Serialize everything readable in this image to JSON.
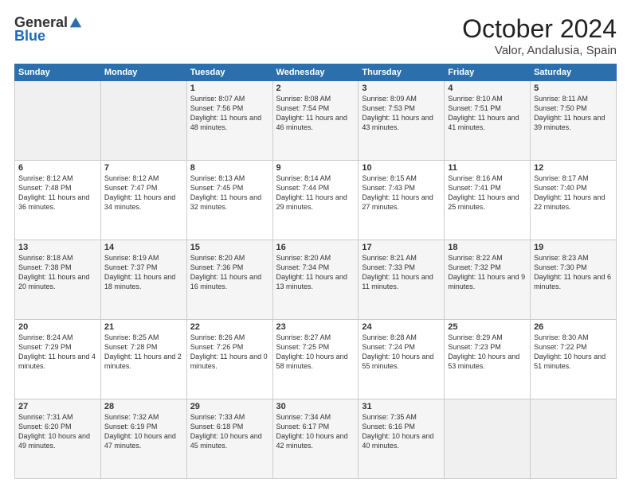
{
  "header": {
    "logo_general": "General",
    "logo_blue": "Blue",
    "month": "October 2024",
    "location": "Valor, Andalusia, Spain"
  },
  "weekdays": [
    "Sunday",
    "Monday",
    "Tuesday",
    "Wednesday",
    "Thursday",
    "Friday",
    "Saturday"
  ],
  "weeks": [
    [
      {
        "day": "",
        "info": ""
      },
      {
        "day": "",
        "info": ""
      },
      {
        "day": "1",
        "info": "Sunrise: 8:07 AM\nSunset: 7:56 PM\nDaylight: 11 hours and 48 minutes."
      },
      {
        "day": "2",
        "info": "Sunrise: 8:08 AM\nSunset: 7:54 PM\nDaylight: 11 hours and 46 minutes."
      },
      {
        "day": "3",
        "info": "Sunrise: 8:09 AM\nSunset: 7:53 PM\nDaylight: 11 hours and 43 minutes."
      },
      {
        "day": "4",
        "info": "Sunrise: 8:10 AM\nSunset: 7:51 PM\nDaylight: 11 hours and 41 minutes."
      },
      {
        "day": "5",
        "info": "Sunrise: 8:11 AM\nSunset: 7:50 PM\nDaylight: 11 hours and 39 minutes."
      }
    ],
    [
      {
        "day": "6",
        "info": "Sunrise: 8:12 AM\nSunset: 7:48 PM\nDaylight: 11 hours and 36 minutes."
      },
      {
        "day": "7",
        "info": "Sunrise: 8:12 AM\nSunset: 7:47 PM\nDaylight: 11 hours and 34 minutes."
      },
      {
        "day": "8",
        "info": "Sunrise: 8:13 AM\nSunset: 7:45 PM\nDaylight: 11 hours and 32 minutes."
      },
      {
        "day": "9",
        "info": "Sunrise: 8:14 AM\nSunset: 7:44 PM\nDaylight: 11 hours and 29 minutes."
      },
      {
        "day": "10",
        "info": "Sunrise: 8:15 AM\nSunset: 7:43 PM\nDaylight: 11 hours and 27 minutes."
      },
      {
        "day": "11",
        "info": "Sunrise: 8:16 AM\nSunset: 7:41 PM\nDaylight: 11 hours and 25 minutes."
      },
      {
        "day": "12",
        "info": "Sunrise: 8:17 AM\nSunset: 7:40 PM\nDaylight: 11 hours and 22 minutes."
      }
    ],
    [
      {
        "day": "13",
        "info": "Sunrise: 8:18 AM\nSunset: 7:38 PM\nDaylight: 11 hours and 20 minutes."
      },
      {
        "day": "14",
        "info": "Sunrise: 8:19 AM\nSunset: 7:37 PM\nDaylight: 11 hours and 18 minutes."
      },
      {
        "day": "15",
        "info": "Sunrise: 8:20 AM\nSunset: 7:36 PM\nDaylight: 11 hours and 16 minutes."
      },
      {
        "day": "16",
        "info": "Sunrise: 8:20 AM\nSunset: 7:34 PM\nDaylight: 11 hours and 13 minutes."
      },
      {
        "day": "17",
        "info": "Sunrise: 8:21 AM\nSunset: 7:33 PM\nDaylight: 11 hours and 11 minutes."
      },
      {
        "day": "18",
        "info": "Sunrise: 8:22 AM\nSunset: 7:32 PM\nDaylight: 11 hours and 9 minutes."
      },
      {
        "day": "19",
        "info": "Sunrise: 8:23 AM\nSunset: 7:30 PM\nDaylight: 11 hours and 6 minutes."
      }
    ],
    [
      {
        "day": "20",
        "info": "Sunrise: 8:24 AM\nSunset: 7:29 PM\nDaylight: 11 hours and 4 minutes."
      },
      {
        "day": "21",
        "info": "Sunrise: 8:25 AM\nSunset: 7:28 PM\nDaylight: 11 hours and 2 minutes."
      },
      {
        "day": "22",
        "info": "Sunrise: 8:26 AM\nSunset: 7:26 PM\nDaylight: 11 hours and 0 minutes."
      },
      {
        "day": "23",
        "info": "Sunrise: 8:27 AM\nSunset: 7:25 PM\nDaylight: 10 hours and 58 minutes."
      },
      {
        "day": "24",
        "info": "Sunrise: 8:28 AM\nSunset: 7:24 PM\nDaylight: 10 hours and 55 minutes."
      },
      {
        "day": "25",
        "info": "Sunrise: 8:29 AM\nSunset: 7:23 PM\nDaylight: 10 hours and 53 minutes."
      },
      {
        "day": "26",
        "info": "Sunrise: 8:30 AM\nSunset: 7:22 PM\nDaylight: 10 hours and 51 minutes."
      }
    ],
    [
      {
        "day": "27",
        "info": "Sunrise: 7:31 AM\nSunset: 6:20 PM\nDaylight: 10 hours and 49 minutes."
      },
      {
        "day": "28",
        "info": "Sunrise: 7:32 AM\nSunset: 6:19 PM\nDaylight: 10 hours and 47 minutes."
      },
      {
        "day": "29",
        "info": "Sunrise: 7:33 AM\nSunset: 6:18 PM\nDaylight: 10 hours and 45 minutes."
      },
      {
        "day": "30",
        "info": "Sunrise: 7:34 AM\nSunset: 6:17 PM\nDaylight: 10 hours and 42 minutes."
      },
      {
        "day": "31",
        "info": "Sunrise: 7:35 AM\nSunset: 6:16 PM\nDaylight: 10 hours and 40 minutes."
      },
      {
        "day": "",
        "info": ""
      },
      {
        "day": "",
        "info": ""
      }
    ]
  ]
}
